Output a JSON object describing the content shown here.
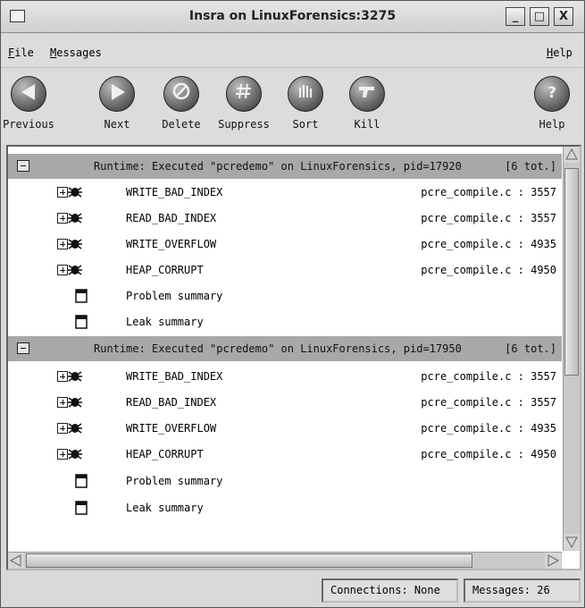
{
  "window": {
    "title": "Insra on LinuxForensics:3275",
    "controls": {
      "minimize": "_",
      "maximize": "□",
      "close": "X"
    }
  },
  "menu": {
    "file": {
      "mnemonic": "F",
      "rest": "ile"
    },
    "messages": {
      "mnemonic": "M",
      "rest": "essages"
    },
    "help": {
      "mnemonic": "H",
      "rest": "elp"
    }
  },
  "toolbar": {
    "previous": {
      "label": "Previous",
      "icon": "arrow-left-icon"
    },
    "next": {
      "label": "Next",
      "icon": "arrow-right-icon"
    },
    "delete": {
      "label": "Delete",
      "icon": "no-entry-icon"
    },
    "suppress": {
      "label": "Suppress",
      "icon": "hash-icon"
    },
    "sort": {
      "label": "Sort",
      "icon": "sort-bars-icon"
    },
    "kill": {
      "label": "Kill",
      "icon": "pistol-icon"
    },
    "help": {
      "label": "Help",
      "icon": "question-icon"
    }
  },
  "groups": [
    {
      "header": "Runtime: Executed \"pcredemo\" on LinuxForensics, pid=17920",
      "total": "[6 tot.]",
      "items": [
        {
          "label": "WRITE_BAD_INDEX",
          "location": "pcre_compile.c : 3557",
          "kind": "error"
        },
        {
          "label": "READ_BAD_INDEX",
          "location": "pcre_compile.c : 3557",
          "kind": "error"
        },
        {
          "label": "WRITE_OVERFLOW",
          "location": "pcre_compile.c : 4935",
          "kind": "error"
        },
        {
          "label": "HEAP_CORRUPT",
          "location": "pcre_compile.c : 4950",
          "kind": "error"
        },
        {
          "label": "Problem summary",
          "location": "",
          "kind": "summary"
        },
        {
          "label": "Leak summary",
          "location": "",
          "kind": "summary"
        }
      ]
    },
    {
      "header": "Runtime: Executed \"pcredemo\" on LinuxForensics, pid=17950",
      "total": "[6 tot.]",
      "items": [
        {
          "label": "WRITE_BAD_INDEX",
          "location": "pcre_compile.c : 3557",
          "kind": "error"
        },
        {
          "label": "READ_BAD_INDEX",
          "location": "pcre_compile.c : 3557",
          "kind": "error"
        },
        {
          "label": "WRITE_OVERFLOW",
          "location": "pcre_compile.c : 4935",
          "kind": "error"
        },
        {
          "label": "HEAP_CORRUPT",
          "location": "pcre_compile.c : 4950",
          "kind": "error"
        },
        {
          "label": "Problem summary",
          "location": "",
          "kind": "summary"
        },
        {
          "label": "Leak summary",
          "location": "",
          "kind": "summary"
        }
      ]
    }
  ],
  "status": {
    "connections": "Connections: None",
    "messages": "Messages: 26"
  }
}
